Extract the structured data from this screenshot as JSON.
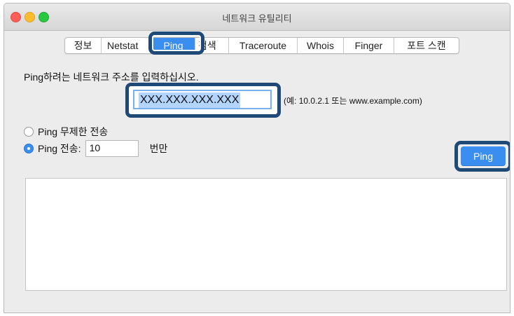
{
  "window": {
    "title": "네트워크 유틸리티"
  },
  "tabs": [
    {
      "label": "정보",
      "active": false
    },
    {
      "label": "Netstat",
      "active": false
    },
    {
      "label": "Ping",
      "active": true
    },
    {
      "label": "검색",
      "active": false
    },
    {
      "label": "Traceroute",
      "active": false
    },
    {
      "label": "Whois",
      "active": false
    },
    {
      "label": "Finger",
      "active": false
    },
    {
      "label": "포트 스캔",
      "active": false
    }
  ],
  "ping": {
    "prompt": "Ping하려는 네트워크 주소를 입력하십시오.",
    "address_value": "XXX.XXX.XXX.XXX",
    "example": "(예: 10.0.2.1 또는 www.example.com)",
    "unlimited_label": "Ping 무제한 전송",
    "limited_label": "Ping 전송:",
    "count_value": "10",
    "count_suffix": "번만",
    "button_label": "Ping",
    "selected_option": "limited"
  },
  "colors": {
    "accent": "#3a8ef0",
    "highlight_frame": "#1f4a78"
  }
}
